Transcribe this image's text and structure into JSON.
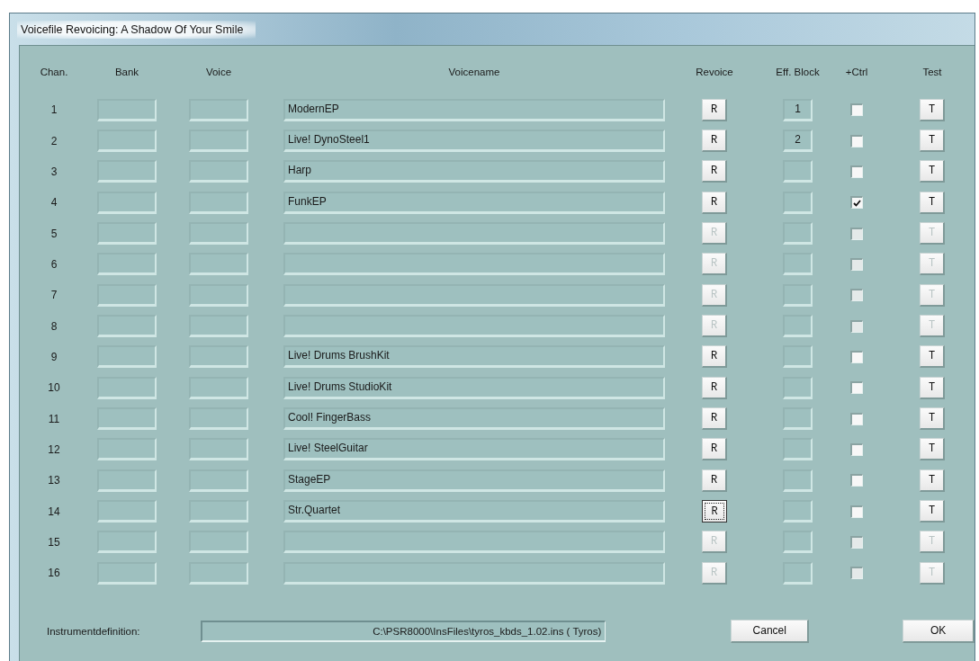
{
  "window": {
    "title": "Voicefile Revoicing:  A Shadow Of Your Smile"
  },
  "columns": [
    "Chan.",
    "Bank",
    "Voice",
    "Voicename",
    "Revoice",
    "Eff. Block",
    "+Ctrl",
    "Test"
  ],
  "rows": [
    {
      "chan": "1",
      "voicename": "ModernEP",
      "revoice": "R",
      "eff_block": "1",
      "ctrl_checked": false,
      "test": "T",
      "enabled": true,
      "focused": false
    },
    {
      "chan": "2",
      "voicename": "Live! DynoSteel1",
      "revoice": "R",
      "eff_block": "2",
      "ctrl_checked": false,
      "test": "T",
      "enabled": true,
      "focused": false
    },
    {
      "chan": "3",
      "voicename": "Harp",
      "revoice": "R",
      "eff_block": "",
      "ctrl_checked": false,
      "test": "T",
      "enabled": true,
      "focused": false
    },
    {
      "chan": "4",
      "voicename": "FunkEP",
      "revoice": "R",
      "eff_block": "",
      "ctrl_checked": true,
      "test": "T",
      "enabled": true,
      "focused": false
    },
    {
      "chan": "5",
      "voicename": "",
      "revoice": "R",
      "eff_block": "",
      "ctrl_checked": false,
      "test": "T",
      "enabled": false,
      "focused": false
    },
    {
      "chan": "6",
      "voicename": "",
      "revoice": "R",
      "eff_block": "",
      "ctrl_checked": false,
      "test": "T",
      "enabled": false,
      "focused": false
    },
    {
      "chan": "7",
      "voicename": "",
      "revoice": "R",
      "eff_block": "",
      "ctrl_checked": false,
      "test": "T",
      "enabled": false,
      "focused": false
    },
    {
      "chan": "8",
      "voicename": "",
      "revoice": "R",
      "eff_block": "",
      "ctrl_checked": false,
      "test": "T",
      "enabled": false,
      "focused": false
    },
    {
      "chan": "9",
      "voicename": "Live! Drums BrushKit",
      "revoice": "R",
      "eff_block": "",
      "ctrl_checked": false,
      "test": "T",
      "enabled": true,
      "focused": false
    },
    {
      "chan": "10",
      "voicename": "Live! Drums StudioKit",
      "revoice": "R",
      "eff_block": "",
      "ctrl_checked": false,
      "test": "T",
      "enabled": true,
      "focused": false
    },
    {
      "chan": "11",
      "voicename": "Cool! FingerBass",
      "revoice": "R",
      "eff_block": "",
      "ctrl_checked": false,
      "test": "T",
      "enabled": true,
      "focused": false
    },
    {
      "chan": "12",
      "voicename": "Live! SteelGuitar",
      "revoice": "R",
      "eff_block": "",
      "ctrl_checked": false,
      "test": "T",
      "enabled": true,
      "focused": false
    },
    {
      "chan": "13",
      "voicename": "StageEP",
      "revoice": "R",
      "eff_block": "",
      "ctrl_checked": false,
      "test": "T",
      "enabled": true,
      "focused": false
    },
    {
      "chan": "14",
      "voicename": "Str.Quartet",
      "revoice": "R",
      "eff_block": "",
      "ctrl_checked": false,
      "test": "T",
      "enabled": true,
      "focused": true
    },
    {
      "chan": "15",
      "voicename": "",
      "revoice": "R",
      "eff_block": "",
      "ctrl_checked": false,
      "test": "T",
      "enabled": false,
      "focused": false
    },
    {
      "chan": "16",
      "voicename": "",
      "revoice": "R",
      "eff_block": "",
      "ctrl_checked": false,
      "test": "T",
      "enabled": false,
      "focused": false
    }
  ],
  "instrument_definition": {
    "label": "Instrumentdefinition:",
    "value": "C:\\PSR8000\\InsFiles\\tyros_kbds_1.02.ins ( Tyros)"
  },
  "buttons": [
    "Cancel",
    "OK"
  ]
}
